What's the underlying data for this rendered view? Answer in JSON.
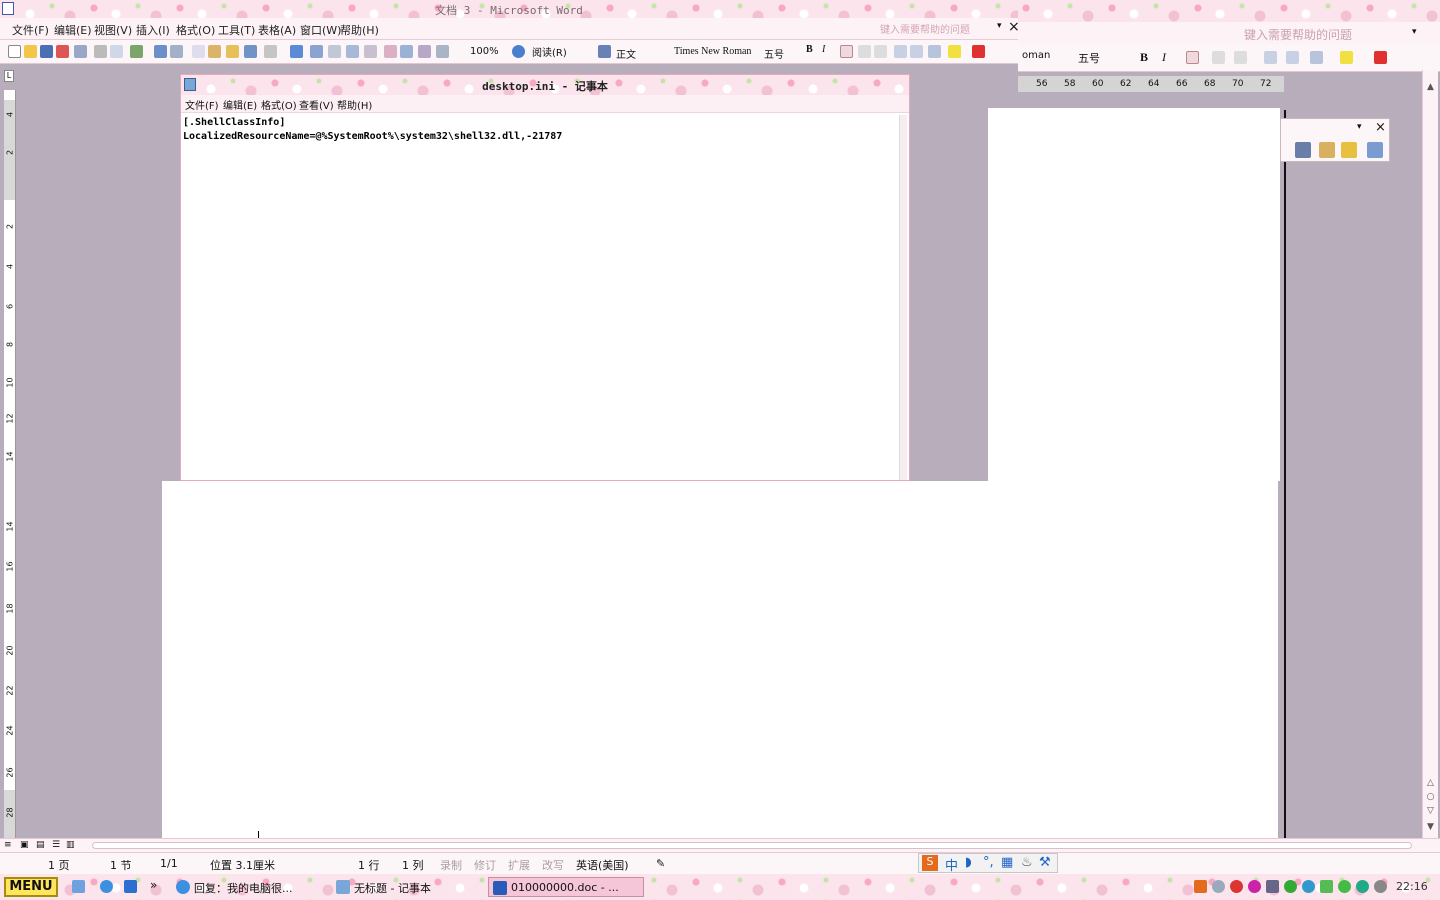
{
  "word": {
    "title": "文档 3 - Microsoft Word",
    "menus": [
      "文件(F)",
      "编辑(E)",
      "视图(V)",
      "插入(I)",
      "格式(O)",
      "工具(T)",
      "表格(A)",
      "窗口(W)",
      "帮助(H)"
    ],
    "help_placeholder": "键入需要帮助的问题",
    "zoom": "100%",
    "read_label": "阅读(R)",
    "style": "正文",
    "font": "Times New Roman",
    "font_size": "五号"
  },
  "word2": {
    "help_placeholder": "键入需要帮助的问题",
    "font_fragment": "oman",
    "font_size": "五号",
    "ruler_numbers": [
      "56",
      "58",
      "60",
      "62",
      "64",
      "66",
      "68",
      "70",
      "72"
    ]
  },
  "notepad": {
    "title": "desktop.ini - 记事本",
    "menus": [
      "文件(F)",
      "编辑(E)",
      "格式(O)",
      "查看(V)",
      "帮助(H)"
    ],
    "lines": [
      "[.ShellClassInfo]",
      "LocalizedResourceName=@%SystemRoot%\\system32\\shell32.dll,-21787"
    ]
  },
  "left_ruler": {
    "numbers": [
      "4",
      "2",
      "2",
      "4",
      "6",
      "8",
      "10",
      "12",
      "14",
      "14",
      "16",
      "18",
      "20",
      "22",
      "24",
      "26",
      "28"
    ]
  },
  "statusbar": {
    "page": "1 页",
    "section": "1 节",
    "page_of": "1/1",
    "position": "位置 3.1厘米",
    "line": "1 行",
    "column": "1 列",
    "rec": "录制",
    "trk": "修订",
    "ext": "扩展",
    "ovr": "改写",
    "language": "英语(美国)"
  },
  "ime": {
    "label": "中"
  },
  "taskbar": {
    "start": "MENU",
    "buttons": [
      {
        "label": "回复：我的电脑很..."
      },
      {
        "label": "无标题 - 记事本"
      },
      {
        "label": "010000000.doc - ..."
      }
    ],
    "clock": "22:16"
  }
}
